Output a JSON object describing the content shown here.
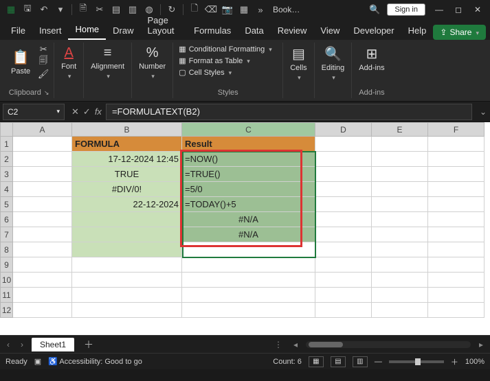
{
  "title": "Book…",
  "signin": "Sign in",
  "share": "Share",
  "tabs": [
    "File",
    "Insert",
    "Home",
    "Draw",
    "Page Layout",
    "Formulas",
    "Data",
    "Review",
    "View",
    "Developer",
    "Help"
  ],
  "active_tab": "Home",
  "ribbon": {
    "clipboard": {
      "paste": "Paste",
      "label": "Clipboard"
    },
    "font": {
      "label": "Font",
      "btn": "Font"
    },
    "alignment": {
      "label": "Alignment",
      "btn": "Alignment"
    },
    "number": {
      "label": "Number",
      "btn": "Number"
    },
    "styles": {
      "label": "Styles",
      "cf": "Conditional Formatting",
      "fat": "Format as Table",
      "cs": "Cell Styles"
    },
    "cells": {
      "label": "Cells",
      "btn": "Cells"
    },
    "editing": {
      "label": "Editing",
      "btn": "Editing"
    },
    "addins": {
      "label": "Add-ins",
      "btn": "Add-ins"
    }
  },
  "namebox": "C2",
  "formula": "=FORMULATEXT(B2)",
  "columns": [
    "A",
    "B",
    "C",
    "D",
    "E",
    "F"
  ],
  "rows": [
    "1",
    "2",
    "3",
    "4",
    "5",
    "6",
    "7",
    "8",
    "9",
    "10",
    "11",
    "12"
  ],
  "grid": {
    "b1": "FORMULA",
    "c1": "Result",
    "b2": "17-12-2024 12:45",
    "c2": "=NOW()",
    "b3": "TRUE",
    "c3": "=TRUE()",
    "b4": "#DIV/0!",
    "c4": "=5/0",
    "b5": "22-12-2024",
    "c5": "=TODAY()+5",
    "c6": "#N/A",
    "c7": "#N/A"
  },
  "sheet": "Sheet1",
  "status": {
    "ready": "Ready",
    "access": "Accessibility: Good to go",
    "count": "Count: 6",
    "zoom": "100%"
  }
}
